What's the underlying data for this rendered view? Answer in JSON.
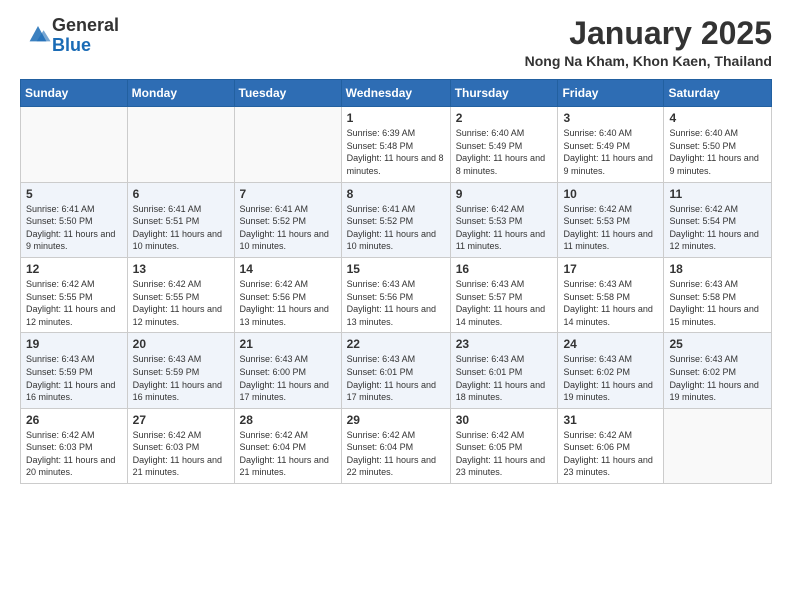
{
  "logo": {
    "general": "General",
    "blue": "Blue"
  },
  "header": {
    "month": "January 2025",
    "location": "Nong Na Kham, Khon Kaen, Thailand"
  },
  "weekdays": [
    "Sunday",
    "Monday",
    "Tuesday",
    "Wednesday",
    "Thursday",
    "Friday",
    "Saturday"
  ],
  "weeks": [
    [
      {
        "day": "",
        "sunrise": "",
        "sunset": "",
        "daylight": ""
      },
      {
        "day": "",
        "sunrise": "",
        "sunset": "",
        "daylight": ""
      },
      {
        "day": "",
        "sunrise": "",
        "sunset": "",
        "daylight": ""
      },
      {
        "day": "1",
        "sunrise": "Sunrise: 6:39 AM",
        "sunset": "Sunset: 5:48 PM",
        "daylight": "Daylight: 11 hours and 8 minutes."
      },
      {
        "day": "2",
        "sunrise": "Sunrise: 6:40 AM",
        "sunset": "Sunset: 5:49 PM",
        "daylight": "Daylight: 11 hours and 8 minutes."
      },
      {
        "day": "3",
        "sunrise": "Sunrise: 6:40 AM",
        "sunset": "Sunset: 5:49 PM",
        "daylight": "Daylight: 11 hours and 9 minutes."
      },
      {
        "day": "4",
        "sunrise": "Sunrise: 6:40 AM",
        "sunset": "Sunset: 5:50 PM",
        "daylight": "Daylight: 11 hours and 9 minutes."
      }
    ],
    [
      {
        "day": "5",
        "sunrise": "Sunrise: 6:41 AM",
        "sunset": "Sunset: 5:50 PM",
        "daylight": "Daylight: 11 hours and 9 minutes."
      },
      {
        "day": "6",
        "sunrise": "Sunrise: 6:41 AM",
        "sunset": "Sunset: 5:51 PM",
        "daylight": "Daylight: 11 hours and 10 minutes."
      },
      {
        "day": "7",
        "sunrise": "Sunrise: 6:41 AM",
        "sunset": "Sunset: 5:52 PM",
        "daylight": "Daylight: 11 hours and 10 minutes."
      },
      {
        "day": "8",
        "sunrise": "Sunrise: 6:41 AM",
        "sunset": "Sunset: 5:52 PM",
        "daylight": "Daylight: 11 hours and 10 minutes."
      },
      {
        "day": "9",
        "sunrise": "Sunrise: 6:42 AM",
        "sunset": "Sunset: 5:53 PM",
        "daylight": "Daylight: 11 hours and 11 minutes."
      },
      {
        "day": "10",
        "sunrise": "Sunrise: 6:42 AM",
        "sunset": "Sunset: 5:53 PM",
        "daylight": "Daylight: 11 hours and 11 minutes."
      },
      {
        "day": "11",
        "sunrise": "Sunrise: 6:42 AM",
        "sunset": "Sunset: 5:54 PM",
        "daylight": "Daylight: 11 hours and 12 minutes."
      }
    ],
    [
      {
        "day": "12",
        "sunrise": "Sunrise: 6:42 AM",
        "sunset": "Sunset: 5:55 PM",
        "daylight": "Daylight: 11 hours and 12 minutes."
      },
      {
        "day": "13",
        "sunrise": "Sunrise: 6:42 AM",
        "sunset": "Sunset: 5:55 PM",
        "daylight": "Daylight: 11 hours and 12 minutes."
      },
      {
        "day": "14",
        "sunrise": "Sunrise: 6:42 AM",
        "sunset": "Sunset: 5:56 PM",
        "daylight": "Daylight: 11 hours and 13 minutes."
      },
      {
        "day": "15",
        "sunrise": "Sunrise: 6:43 AM",
        "sunset": "Sunset: 5:56 PM",
        "daylight": "Daylight: 11 hours and 13 minutes."
      },
      {
        "day": "16",
        "sunrise": "Sunrise: 6:43 AM",
        "sunset": "Sunset: 5:57 PM",
        "daylight": "Daylight: 11 hours and 14 minutes."
      },
      {
        "day": "17",
        "sunrise": "Sunrise: 6:43 AM",
        "sunset": "Sunset: 5:58 PM",
        "daylight": "Daylight: 11 hours and 14 minutes."
      },
      {
        "day": "18",
        "sunrise": "Sunrise: 6:43 AM",
        "sunset": "Sunset: 5:58 PM",
        "daylight": "Daylight: 11 hours and 15 minutes."
      }
    ],
    [
      {
        "day": "19",
        "sunrise": "Sunrise: 6:43 AM",
        "sunset": "Sunset: 5:59 PM",
        "daylight": "Daylight: 11 hours and 16 minutes."
      },
      {
        "day": "20",
        "sunrise": "Sunrise: 6:43 AM",
        "sunset": "Sunset: 5:59 PM",
        "daylight": "Daylight: 11 hours and 16 minutes."
      },
      {
        "day": "21",
        "sunrise": "Sunrise: 6:43 AM",
        "sunset": "Sunset: 6:00 PM",
        "daylight": "Daylight: 11 hours and 17 minutes."
      },
      {
        "day": "22",
        "sunrise": "Sunrise: 6:43 AM",
        "sunset": "Sunset: 6:01 PM",
        "daylight": "Daylight: 11 hours and 17 minutes."
      },
      {
        "day": "23",
        "sunrise": "Sunrise: 6:43 AM",
        "sunset": "Sunset: 6:01 PM",
        "daylight": "Daylight: 11 hours and 18 minutes."
      },
      {
        "day": "24",
        "sunrise": "Sunrise: 6:43 AM",
        "sunset": "Sunset: 6:02 PM",
        "daylight": "Daylight: 11 hours and 19 minutes."
      },
      {
        "day": "25",
        "sunrise": "Sunrise: 6:43 AM",
        "sunset": "Sunset: 6:02 PM",
        "daylight": "Daylight: 11 hours and 19 minutes."
      }
    ],
    [
      {
        "day": "26",
        "sunrise": "Sunrise: 6:42 AM",
        "sunset": "Sunset: 6:03 PM",
        "daylight": "Daylight: 11 hours and 20 minutes."
      },
      {
        "day": "27",
        "sunrise": "Sunrise: 6:42 AM",
        "sunset": "Sunset: 6:03 PM",
        "daylight": "Daylight: 11 hours and 21 minutes."
      },
      {
        "day": "28",
        "sunrise": "Sunrise: 6:42 AM",
        "sunset": "Sunset: 6:04 PM",
        "daylight": "Daylight: 11 hours and 21 minutes."
      },
      {
        "day": "29",
        "sunrise": "Sunrise: 6:42 AM",
        "sunset": "Sunset: 6:04 PM",
        "daylight": "Daylight: 11 hours and 22 minutes."
      },
      {
        "day": "30",
        "sunrise": "Sunrise: 6:42 AM",
        "sunset": "Sunset: 6:05 PM",
        "daylight": "Daylight: 11 hours and 23 minutes."
      },
      {
        "day": "31",
        "sunrise": "Sunrise: 6:42 AM",
        "sunset": "Sunset: 6:06 PM",
        "daylight": "Daylight: 11 hours and 23 minutes."
      },
      {
        "day": "",
        "sunrise": "",
        "sunset": "",
        "daylight": ""
      }
    ]
  ]
}
